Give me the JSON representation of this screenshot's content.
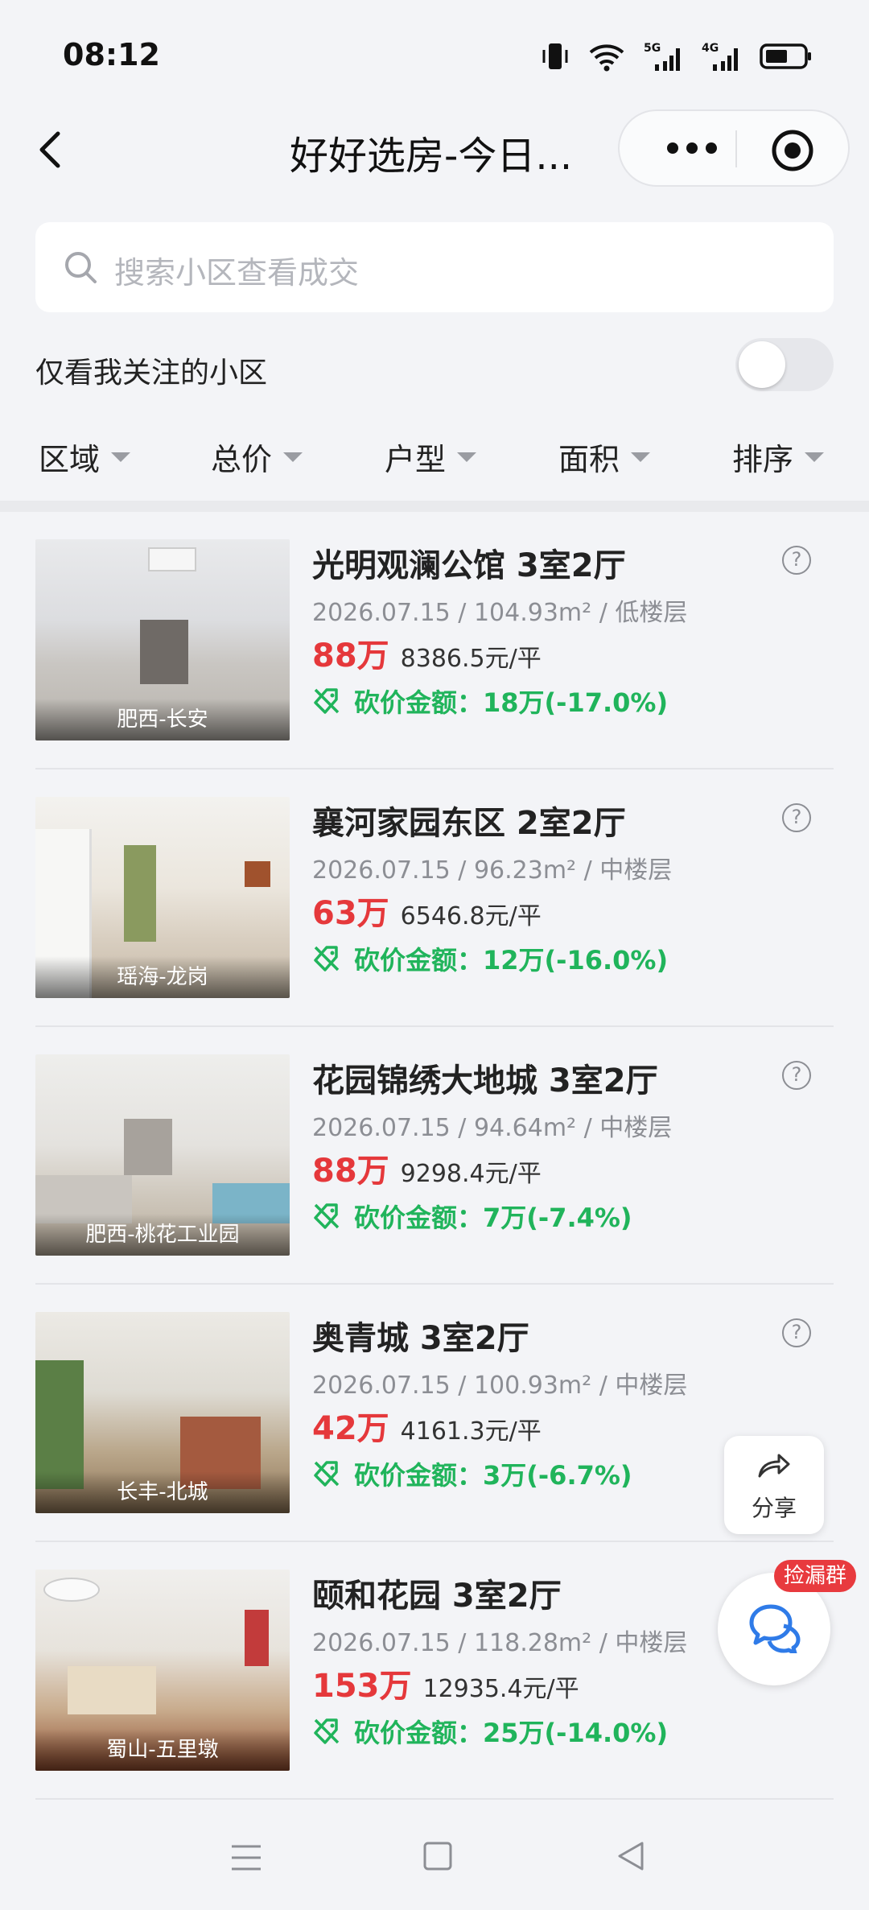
{
  "status": {
    "time": "08:12",
    "net1": "5G",
    "net2": "4G"
  },
  "nav": {
    "title": "好好选房-今日..."
  },
  "search": {
    "placeholder": "搜索小区查看成交"
  },
  "follow_label": "仅看我关注的小区",
  "filters": [
    "区域",
    "总价",
    "户型",
    "面积",
    "排序"
  ],
  "listings": [
    {
      "name": "光明观澜公馆 3室2厅",
      "meta": "2026.07.15 / 104.93m² / 低楼层",
      "total": "88万",
      "unit_price": "8386.5元/平",
      "cut": "砍价金额：18万(-17.0%)",
      "location": "肥西-长安"
    },
    {
      "name": "襄河家园东区 2室2厅",
      "meta": "2026.07.15 / 96.23m² / 中楼层",
      "total": "63万",
      "unit_price": "6546.8元/平",
      "cut": "砍价金额：12万(-16.0%)",
      "location": "瑶海-龙岗"
    },
    {
      "name": "花园锦绣大地城 3室2厅",
      "meta": "2026.07.15 / 94.64m² / 中楼层",
      "total": "88万",
      "unit_price": "9298.4元/平",
      "cut": "砍价金额：7万(-7.4%)",
      "location": "肥西-桃花工业园"
    },
    {
      "name": "奥青城 3室2厅",
      "meta": "2026.07.15 / 100.93m² / 中楼层",
      "total": "42万",
      "unit_price": "4161.3元/平",
      "cut": "砍价金额：3万(-6.7%)",
      "location": "长丰-北城"
    },
    {
      "name": "颐和花园 3室2厅",
      "meta": "2026.07.15 / 118.28m² / 中楼层",
      "total": "153万",
      "unit_price": "12935.4元/平",
      "cut": "砍价金额：25万(-14.0%)",
      "location": "蜀山-五里墩"
    }
  ],
  "share_label": "分享",
  "chat_badge": "捡漏群",
  "colors": {
    "price_red": "#e5383b",
    "cut_green": "#20b45b",
    "badge_red": "#e83a3e"
  }
}
